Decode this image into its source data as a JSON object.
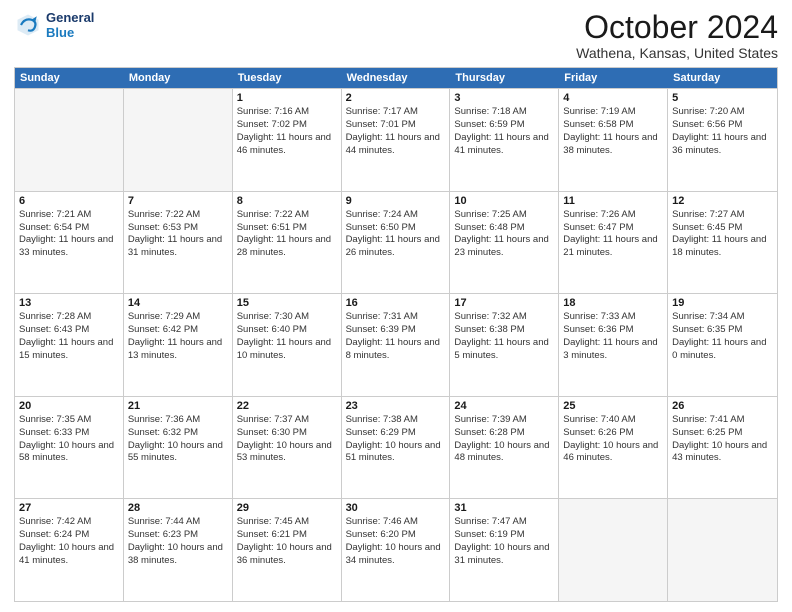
{
  "logo": {
    "line1": "General",
    "line2": "Blue"
  },
  "title": "October 2024",
  "location": "Wathena, Kansas, United States",
  "days_header": [
    "Sunday",
    "Monday",
    "Tuesday",
    "Wednesday",
    "Thursday",
    "Friday",
    "Saturday"
  ],
  "weeks": [
    [
      {
        "day": "",
        "sunrise": "",
        "sunset": "",
        "daylight": ""
      },
      {
        "day": "",
        "sunrise": "",
        "sunset": "",
        "daylight": ""
      },
      {
        "day": "1",
        "sunrise": "Sunrise: 7:16 AM",
        "sunset": "Sunset: 7:02 PM",
        "daylight": "Daylight: 11 hours and 46 minutes."
      },
      {
        "day": "2",
        "sunrise": "Sunrise: 7:17 AM",
        "sunset": "Sunset: 7:01 PM",
        "daylight": "Daylight: 11 hours and 44 minutes."
      },
      {
        "day": "3",
        "sunrise": "Sunrise: 7:18 AM",
        "sunset": "Sunset: 6:59 PM",
        "daylight": "Daylight: 11 hours and 41 minutes."
      },
      {
        "day": "4",
        "sunrise": "Sunrise: 7:19 AM",
        "sunset": "Sunset: 6:58 PM",
        "daylight": "Daylight: 11 hours and 38 minutes."
      },
      {
        "day": "5",
        "sunrise": "Sunrise: 7:20 AM",
        "sunset": "Sunset: 6:56 PM",
        "daylight": "Daylight: 11 hours and 36 minutes."
      }
    ],
    [
      {
        "day": "6",
        "sunrise": "Sunrise: 7:21 AM",
        "sunset": "Sunset: 6:54 PM",
        "daylight": "Daylight: 11 hours and 33 minutes."
      },
      {
        "day": "7",
        "sunrise": "Sunrise: 7:22 AM",
        "sunset": "Sunset: 6:53 PM",
        "daylight": "Daylight: 11 hours and 31 minutes."
      },
      {
        "day": "8",
        "sunrise": "Sunrise: 7:22 AM",
        "sunset": "Sunset: 6:51 PM",
        "daylight": "Daylight: 11 hours and 28 minutes."
      },
      {
        "day": "9",
        "sunrise": "Sunrise: 7:24 AM",
        "sunset": "Sunset: 6:50 PM",
        "daylight": "Daylight: 11 hours and 26 minutes."
      },
      {
        "day": "10",
        "sunrise": "Sunrise: 7:25 AM",
        "sunset": "Sunset: 6:48 PM",
        "daylight": "Daylight: 11 hours and 23 minutes."
      },
      {
        "day": "11",
        "sunrise": "Sunrise: 7:26 AM",
        "sunset": "Sunset: 6:47 PM",
        "daylight": "Daylight: 11 hours and 21 minutes."
      },
      {
        "day": "12",
        "sunrise": "Sunrise: 7:27 AM",
        "sunset": "Sunset: 6:45 PM",
        "daylight": "Daylight: 11 hours and 18 minutes."
      }
    ],
    [
      {
        "day": "13",
        "sunrise": "Sunrise: 7:28 AM",
        "sunset": "Sunset: 6:43 PM",
        "daylight": "Daylight: 11 hours and 15 minutes."
      },
      {
        "day": "14",
        "sunrise": "Sunrise: 7:29 AM",
        "sunset": "Sunset: 6:42 PM",
        "daylight": "Daylight: 11 hours and 13 minutes."
      },
      {
        "day": "15",
        "sunrise": "Sunrise: 7:30 AM",
        "sunset": "Sunset: 6:40 PM",
        "daylight": "Daylight: 11 hours and 10 minutes."
      },
      {
        "day": "16",
        "sunrise": "Sunrise: 7:31 AM",
        "sunset": "Sunset: 6:39 PM",
        "daylight": "Daylight: 11 hours and 8 minutes."
      },
      {
        "day": "17",
        "sunrise": "Sunrise: 7:32 AM",
        "sunset": "Sunset: 6:38 PM",
        "daylight": "Daylight: 11 hours and 5 minutes."
      },
      {
        "day": "18",
        "sunrise": "Sunrise: 7:33 AM",
        "sunset": "Sunset: 6:36 PM",
        "daylight": "Daylight: 11 hours and 3 minutes."
      },
      {
        "day": "19",
        "sunrise": "Sunrise: 7:34 AM",
        "sunset": "Sunset: 6:35 PM",
        "daylight": "Daylight: 11 hours and 0 minutes."
      }
    ],
    [
      {
        "day": "20",
        "sunrise": "Sunrise: 7:35 AM",
        "sunset": "Sunset: 6:33 PM",
        "daylight": "Daylight: 10 hours and 58 minutes."
      },
      {
        "day": "21",
        "sunrise": "Sunrise: 7:36 AM",
        "sunset": "Sunset: 6:32 PM",
        "daylight": "Daylight: 10 hours and 55 minutes."
      },
      {
        "day": "22",
        "sunrise": "Sunrise: 7:37 AM",
        "sunset": "Sunset: 6:30 PM",
        "daylight": "Daylight: 10 hours and 53 minutes."
      },
      {
        "day": "23",
        "sunrise": "Sunrise: 7:38 AM",
        "sunset": "Sunset: 6:29 PM",
        "daylight": "Daylight: 10 hours and 51 minutes."
      },
      {
        "day": "24",
        "sunrise": "Sunrise: 7:39 AM",
        "sunset": "Sunset: 6:28 PM",
        "daylight": "Daylight: 10 hours and 48 minutes."
      },
      {
        "day": "25",
        "sunrise": "Sunrise: 7:40 AM",
        "sunset": "Sunset: 6:26 PM",
        "daylight": "Daylight: 10 hours and 46 minutes."
      },
      {
        "day": "26",
        "sunrise": "Sunrise: 7:41 AM",
        "sunset": "Sunset: 6:25 PM",
        "daylight": "Daylight: 10 hours and 43 minutes."
      }
    ],
    [
      {
        "day": "27",
        "sunrise": "Sunrise: 7:42 AM",
        "sunset": "Sunset: 6:24 PM",
        "daylight": "Daylight: 10 hours and 41 minutes."
      },
      {
        "day": "28",
        "sunrise": "Sunrise: 7:44 AM",
        "sunset": "Sunset: 6:23 PM",
        "daylight": "Daylight: 10 hours and 38 minutes."
      },
      {
        "day": "29",
        "sunrise": "Sunrise: 7:45 AM",
        "sunset": "Sunset: 6:21 PM",
        "daylight": "Daylight: 10 hours and 36 minutes."
      },
      {
        "day": "30",
        "sunrise": "Sunrise: 7:46 AM",
        "sunset": "Sunset: 6:20 PM",
        "daylight": "Daylight: 10 hours and 34 minutes."
      },
      {
        "day": "31",
        "sunrise": "Sunrise: 7:47 AM",
        "sunset": "Sunset: 6:19 PM",
        "daylight": "Daylight: 10 hours and 31 minutes."
      },
      {
        "day": "",
        "sunrise": "",
        "sunset": "",
        "daylight": ""
      },
      {
        "day": "",
        "sunrise": "",
        "sunset": "",
        "daylight": ""
      }
    ]
  ]
}
